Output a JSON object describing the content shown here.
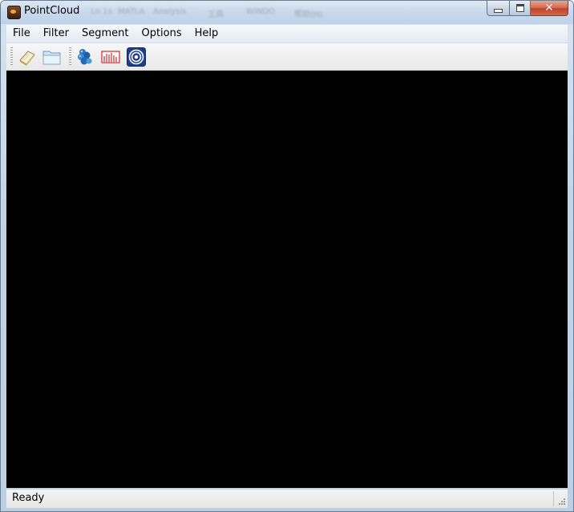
{
  "window": {
    "title": "PointCloud",
    "title_bar_background_ghost_labels": [
      "Ln 1s",
      "MATLA",
      "Analysis",
      "工具",
      "WINDO",
      "帮助(H)"
    ]
  },
  "caption_buttons": {
    "minimize_icon": "minimize-icon",
    "maximize_icon": "maximize-icon",
    "close_glyph": "✕"
  },
  "menubar": {
    "items": [
      {
        "label": "File"
      },
      {
        "label": "Filter"
      },
      {
        "label": "Segment"
      },
      {
        "label": "Options"
      },
      {
        "label": "Help"
      }
    ]
  },
  "toolbar": {
    "buttons": [
      {
        "icon": "new-document-icon"
      },
      {
        "icon": "open-folder-icon"
      },
      {
        "icon": "point-cloud-icon"
      },
      {
        "icon": "histogram-icon"
      },
      {
        "icon": "target-icon"
      }
    ]
  },
  "viewport": {
    "background": "#000000"
  },
  "statusbar": {
    "text": "Ready"
  },
  "colors": {
    "titlebar": "#c9d9ec",
    "close_button": "#c0432a",
    "viewport": "#000000"
  }
}
